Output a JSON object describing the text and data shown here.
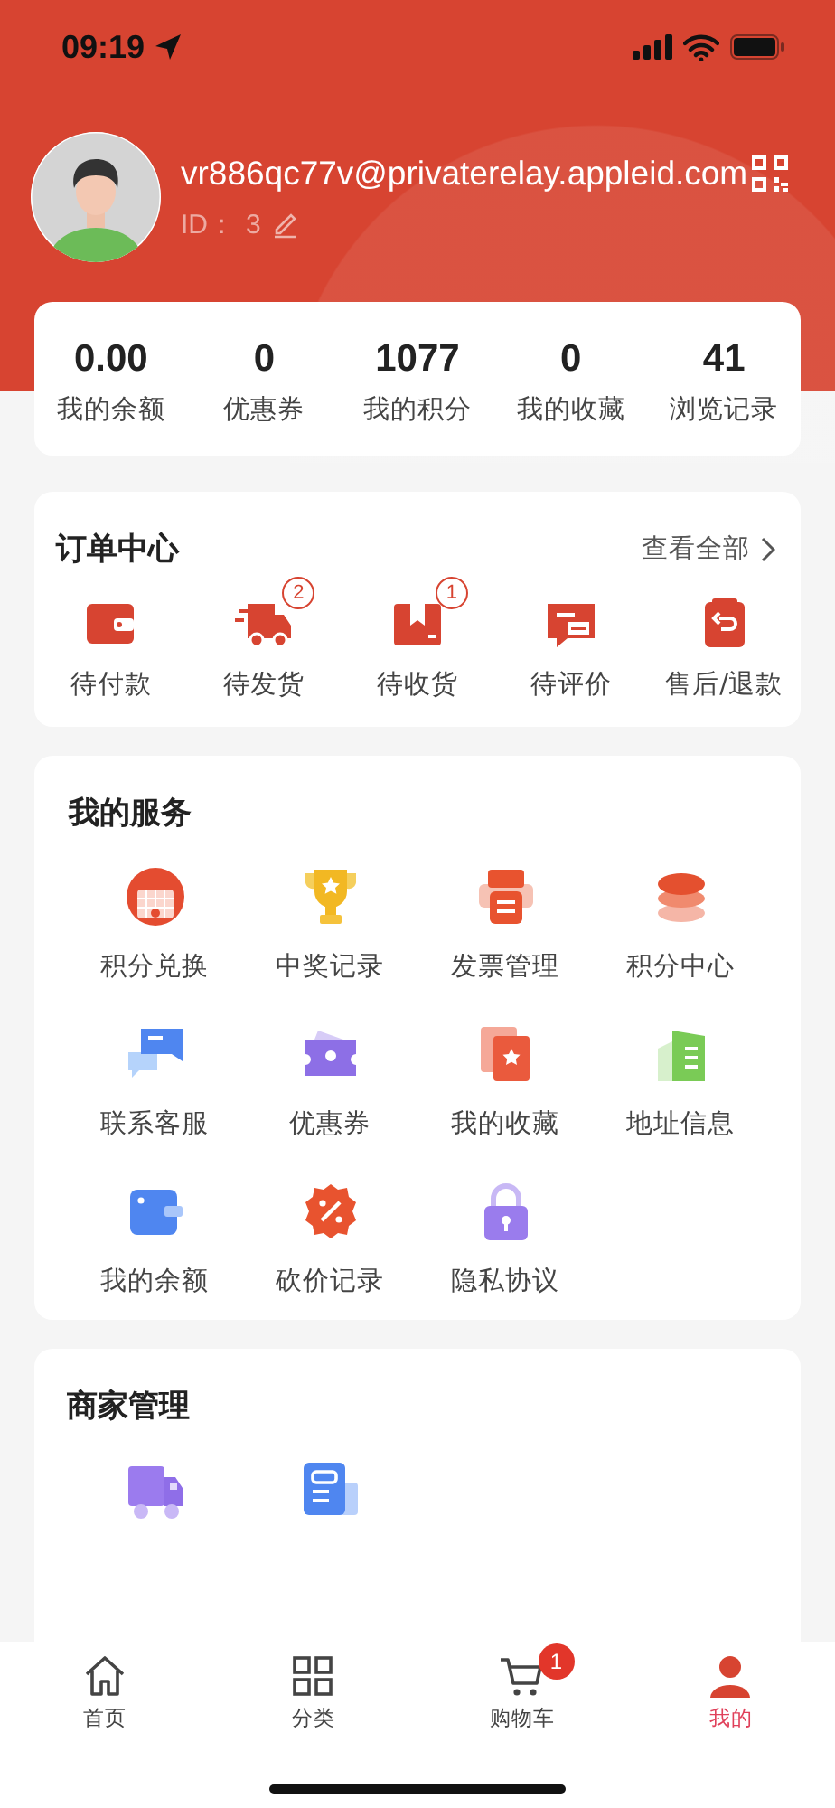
{
  "status_bar": {
    "time": "09:19"
  },
  "profile": {
    "email": "vr886qc77v@privaterelay.appleid.com",
    "id_label": "ID：",
    "id_value": "3"
  },
  "stats": [
    {
      "value": "0.00",
      "label": "我的余额"
    },
    {
      "value": "0",
      "label": "优惠券"
    },
    {
      "value": "1077",
      "label": "我的积分"
    },
    {
      "value": "0",
      "label": "我的收藏"
    },
    {
      "value": "41",
      "label": "浏览记录"
    }
  ],
  "orders": {
    "title": "订单中心",
    "view_all": "查看全部",
    "items": [
      {
        "label": "待付款"
      },
      {
        "label": "待发货",
        "badge": "2"
      },
      {
        "label": "待收货",
        "badge": "1"
      },
      {
        "label": "待评价"
      },
      {
        "label": "售后/退款"
      }
    ]
  },
  "services": {
    "title": "我的服务",
    "items": [
      {
        "label": "积分兑换"
      },
      {
        "label": "中奖记录"
      },
      {
        "label": "发票管理"
      },
      {
        "label": "积分中心"
      },
      {
        "label": "联系客服"
      },
      {
        "label": "优惠券"
      },
      {
        "label": "我的收藏"
      },
      {
        "label": "地址信息"
      },
      {
        "label": "我的余额"
      },
      {
        "label": "砍价记录"
      },
      {
        "label": "隐私协议"
      }
    ]
  },
  "merchant": {
    "title": "商家管理"
  },
  "tab_bar": [
    {
      "label": "首页",
      "selected": false
    },
    {
      "label": "分类",
      "selected": false
    },
    {
      "label": "购物车",
      "selected": false,
      "badge": "1"
    },
    {
      "label": "我的",
      "selected": true
    }
  ]
}
